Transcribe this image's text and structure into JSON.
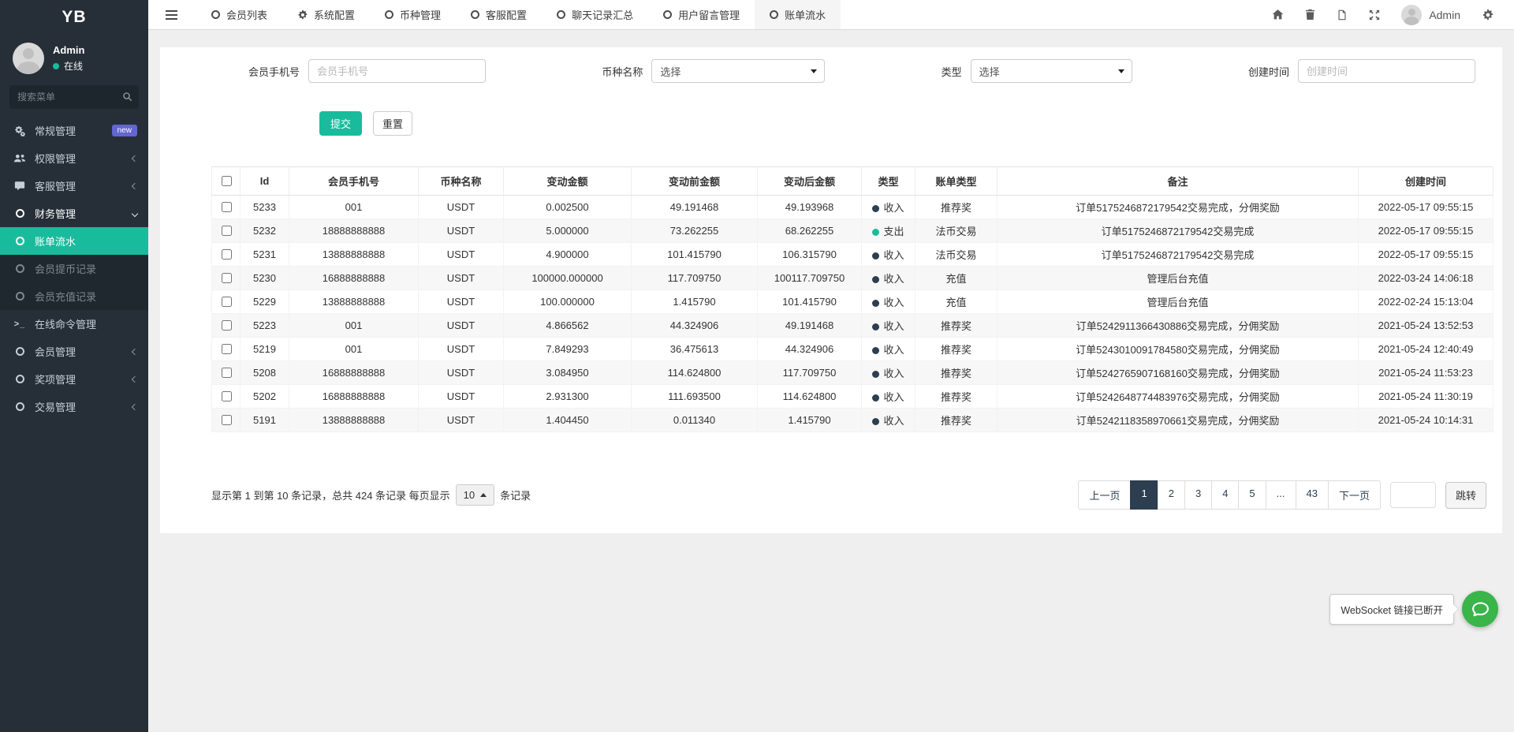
{
  "brand": "YB",
  "sidebar": {
    "user_name": "Admin",
    "user_status": "在线",
    "search_placeholder": "搜索菜单",
    "menu": [
      {
        "label": "常规管理",
        "icon": "gears",
        "badge": "new"
      },
      {
        "label": "权限管理",
        "icon": "users",
        "chevron": "left"
      },
      {
        "label": "客服管理",
        "icon": "comment",
        "chevron": "left"
      },
      {
        "label": "财务管理",
        "icon": "circle",
        "chevron": "down",
        "open": true
      },
      {
        "label": "账单流水",
        "icon": "circle",
        "sub": true,
        "active": true
      },
      {
        "label": "会员提币记录",
        "icon": "circle",
        "sub": true,
        "dim": true
      },
      {
        "label": "会员充值记录",
        "icon": "circle",
        "sub": true,
        "dim": true
      },
      {
        "label": "在线命令管理",
        "icon": "terminal"
      },
      {
        "label": "会员管理",
        "icon": "circle",
        "chevron": "left"
      },
      {
        "label": "奖项管理",
        "icon": "circle",
        "chevron": "left"
      },
      {
        "label": "交易管理",
        "icon": "circle",
        "chevron": "left"
      }
    ]
  },
  "topnav": {
    "tabs": [
      {
        "label": "会员列表",
        "icon": "circle"
      },
      {
        "label": "系统配置",
        "icon": "gear"
      },
      {
        "label": "币种管理",
        "icon": "circle"
      },
      {
        "label": "客服配置",
        "icon": "circle"
      },
      {
        "label": "聊天记录汇总",
        "icon": "circle"
      },
      {
        "label": "用户留言管理",
        "icon": "circle"
      },
      {
        "label": "账单流水",
        "icon": "circle",
        "active": true
      }
    ],
    "user_label": "Admin"
  },
  "filters": {
    "phone_label": "会员手机号",
    "phone_placeholder": "会员手机号",
    "currency_label": "币种名称",
    "currency_value": "选择",
    "type_label": "类型",
    "type_value": "选择",
    "time_label": "创建时间",
    "time_placeholder": "创建时间",
    "submit_label": "提交",
    "reset_label": "重置"
  },
  "table": {
    "headers": [
      "Id",
      "会员手机号",
      "币种名称",
      "变动金额",
      "变动前金额",
      "变动后金额",
      "类型",
      "账单类型",
      "备注",
      "创建时间"
    ],
    "rows": [
      {
        "id": "5233",
        "phone": "001",
        "coin": "USDT",
        "amount": "0.002500",
        "before": "49.191468",
        "after": "49.193968",
        "type": "收入",
        "kind": "income",
        "bill": "推荐奖",
        "remark": "订单5175246872179542交易完成，分佣奖励",
        "time": "2022-05-17 09:55:15"
      },
      {
        "id": "5232",
        "phone": "18888888888",
        "coin": "USDT",
        "amount": "5.000000",
        "before": "73.262255",
        "after": "68.262255",
        "type": "支出",
        "kind": "expense",
        "bill": "法币交易",
        "remark": "订单5175246872179542交易完成",
        "time": "2022-05-17 09:55:15"
      },
      {
        "id": "5231",
        "phone": "13888888888",
        "coin": "USDT",
        "amount": "4.900000",
        "before": "101.415790",
        "after": "106.315790",
        "type": "收入",
        "kind": "income",
        "bill": "法币交易",
        "remark": "订单5175246872179542交易完成",
        "time": "2022-05-17 09:55:15"
      },
      {
        "id": "5230",
        "phone": "16888888888",
        "coin": "USDT",
        "amount": "100000.000000",
        "before": "117.709750",
        "after": "100117.709750",
        "type": "收入",
        "kind": "income",
        "bill": "充值",
        "remark": "管理后台充值",
        "time": "2022-03-24 14:06:18"
      },
      {
        "id": "5229",
        "phone": "13888888888",
        "coin": "USDT",
        "amount": "100.000000",
        "before": "1.415790",
        "after": "101.415790",
        "type": "收入",
        "kind": "income",
        "bill": "充值",
        "remark": "管理后台充值",
        "time": "2022-02-24 15:13:04"
      },
      {
        "id": "5223",
        "phone": "001",
        "coin": "USDT",
        "amount": "4.866562",
        "before": "44.324906",
        "after": "49.191468",
        "type": "收入",
        "kind": "income",
        "bill": "推荐奖",
        "remark": "订单5242911366430886交易完成，分佣奖励",
        "time": "2021-05-24 13:52:53"
      },
      {
        "id": "5219",
        "phone": "001",
        "coin": "USDT",
        "amount": "7.849293",
        "before": "36.475613",
        "after": "44.324906",
        "type": "收入",
        "kind": "income",
        "bill": "推荐奖",
        "remark": "订单5243010091784580交易完成，分佣奖励",
        "time": "2021-05-24 12:40:49"
      },
      {
        "id": "5208",
        "phone": "16888888888",
        "coin": "USDT",
        "amount": "3.084950",
        "before": "114.624800",
        "after": "117.709750",
        "type": "收入",
        "kind": "income",
        "bill": "推荐奖",
        "remark": "订单5242765907168160交易完成，分佣奖励",
        "time": "2021-05-24 11:53:23"
      },
      {
        "id": "5202",
        "phone": "16888888888",
        "coin": "USDT",
        "amount": "2.931300",
        "before": "111.693500",
        "after": "114.624800",
        "type": "收入",
        "kind": "income",
        "bill": "推荐奖",
        "remark": "订单5242648774483976交易完成，分佣奖励",
        "time": "2021-05-24 11:30:19"
      },
      {
        "id": "5191",
        "phone": "13888888888",
        "coin": "USDT",
        "amount": "1.404450",
        "before": "0.011340",
        "after": "1.415790",
        "type": "收入",
        "kind": "income",
        "bill": "推荐奖",
        "remark": "订单5242118358970661交易完成，分佣奖励",
        "time": "2021-05-24 10:14:31"
      }
    ]
  },
  "pagination": {
    "summary_prefix": "显示第 1 到第 10 条记录，总共 424 条记录 每页显示",
    "page_size": "10",
    "summary_suffix": "条记录",
    "items": [
      {
        "label": "上一页",
        "type": "prev"
      },
      {
        "label": "1",
        "active": true
      },
      {
        "label": "2"
      },
      {
        "label": "3"
      },
      {
        "label": "4"
      },
      {
        "label": "5"
      },
      {
        "label": "...",
        "type": "ellipsis"
      },
      {
        "label": "43"
      },
      {
        "label": "下一页",
        "type": "next"
      }
    ],
    "jump_label": "跳转"
  },
  "toast": {
    "message": "WebSocket 链接已断开"
  }
}
